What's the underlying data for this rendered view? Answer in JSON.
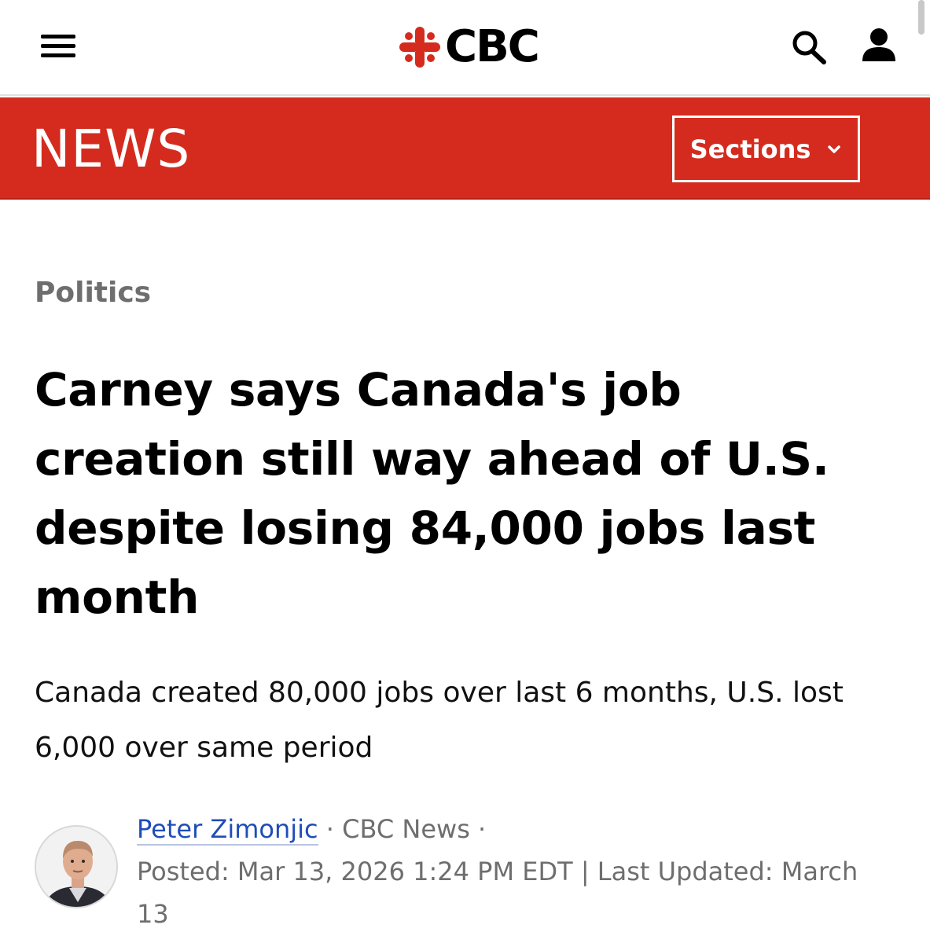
{
  "header": {
    "logo_text": "CBC",
    "menu_icon": "hamburger-menu-icon",
    "search_icon": "search-icon",
    "account_icon": "account-icon"
  },
  "newsbar": {
    "title": "NEWS",
    "sections_label": "Sections",
    "sections_icon": "chevron-down-icon",
    "color": "#d52b1e"
  },
  "article": {
    "category": "Politics",
    "headline": "Carney says Canada's job creation still way ahead of U.S. despite losing 84,000 jobs last month",
    "deck": "Canada created 80,000 jobs over last 6 months, U.S. lost 6,000 over same period",
    "author": "Peter Zimonjic",
    "separator1": " · ",
    "source": "CBC News",
    "separator2": " ·",
    "posted": "Posted: Mar 13, 2026 1:24 PM EDT | Last Updated: March 13"
  },
  "colors": {
    "brand_red": "#d52b1e",
    "category_gray": "#6e6e6e",
    "author_link": "#1f4db8"
  }
}
